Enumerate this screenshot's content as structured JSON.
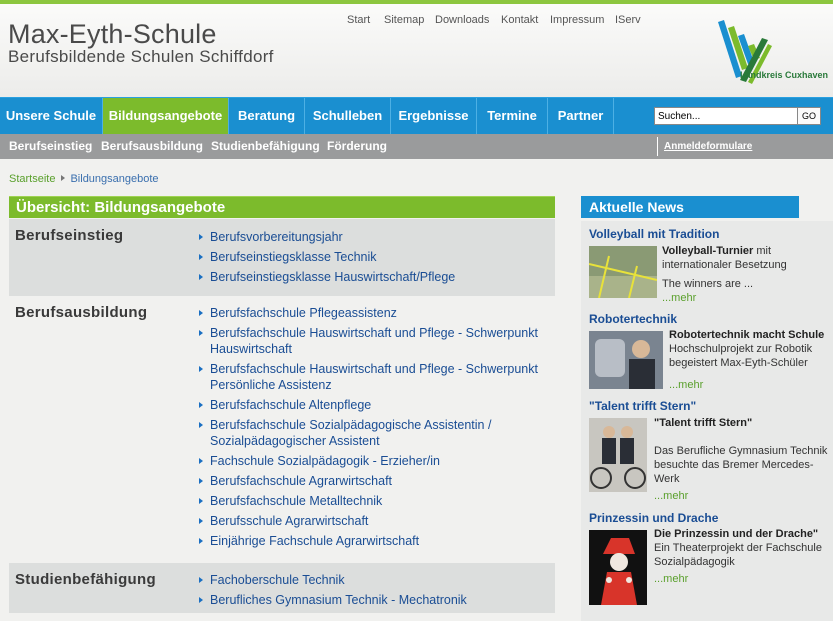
{
  "site": {
    "title": "Max-Eyth-Schule",
    "subtitle": "Berufsbildende Schulen Schiffdorf",
    "logo_text": "Landkreis Cuxhaven"
  },
  "toplinks": [
    "Start",
    "Sitemap",
    "Downloads",
    "Kontakt",
    "Impressum",
    "IServ"
  ],
  "mainnav": [
    "Unsere Schule",
    "Bildungsangebote",
    "Beratung",
    "Schulleben",
    "Ergebnisse",
    "Termine",
    "Partner"
  ],
  "search": {
    "placeholder": "Suchen...",
    "value": "Suchen...",
    "button": "GO"
  },
  "subnav": [
    "Berufseinstieg",
    "Berufsausbildung",
    "Studienbefähigung",
    "Förderung"
  ],
  "subnav_right": "Anmeldeformulare",
  "breadcrumb": {
    "home": "Startseite",
    "current": "Bildungsangebote"
  },
  "overview_title": "Übersicht: Bildungsangebote",
  "sections": [
    {
      "title": "Berufseinstieg",
      "links": [
        "Berufsvorbereitungsjahr",
        "Berufseinstiegsklasse Technik",
        "Berufseinstiegsklasse Hauswirtschaft/Pflege"
      ]
    },
    {
      "title": "Berufsausbildung",
      "links": [
        "Berufsfachschule Pflegeassistenz",
        "Berufsfachschule Hauswirtschaft und Pflege - Schwerpunkt Hauswirtschaft",
        "Berufsfachschule Hauswirtschaft und Pflege - Schwerpunkt Persönliche Assistenz",
        "Berufsfachschule Altenpflege",
        "Berufsfachschule Sozialpädagogische Assistentin / Sozialpädagogischer Assistent",
        "Fachschule Sozialpädagogik - Erzieher/in",
        "Berufsfachschule Agrarwirtschaft",
        "Berufsfachschule Metalltechnik",
        "Berufsschule Agrarwirtschaft",
        "Einjährige Fachschule Agrarwirtschaft"
      ]
    },
    {
      "title": "Studienbefähigung",
      "links": [
        "Fachoberschule Technik",
        "Berufliches Gymnasium Technik - Mechatronik"
      ]
    }
  ],
  "news": {
    "heading": "Aktuelle News",
    "items": [
      {
        "title": "Volleyball mit Tradition",
        "headline": "Volleyball-Turnier",
        "text": " mit internationaler Besetzung",
        "text2": "The winners are ...",
        "more": "...mehr"
      },
      {
        "title": "Robotertechnik",
        "headline": "Robotertechnik macht Schule",
        "text": "Hochschulprojekt zur Robotik begeistert Max-Eyth-Schüler",
        "more": "...mehr"
      },
      {
        "title": "\"Talent trifft Stern\"",
        "headline": "\"Talent trifft Stern\"",
        "text": "Das Berufliche Gymnasium Technik besuchte das Bremer Mercedes-Werk",
        "more": "...mehr"
      },
      {
        "title": "Prinzessin und Drache",
        "headline": "Die Prinzessin und der Drache\"",
        "text": "Ein Theaterprojekt der Fachschule Sozialpädagogik",
        "more": "...mehr"
      }
    ]
  },
  "colors": {
    "blue_nav": "#1a8fd0",
    "green_active": "#7cbb2c",
    "grey_subnav": "#9a9b9c",
    "link_blue": "#1a4d94",
    "more_green": "#5aa02c"
  }
}
